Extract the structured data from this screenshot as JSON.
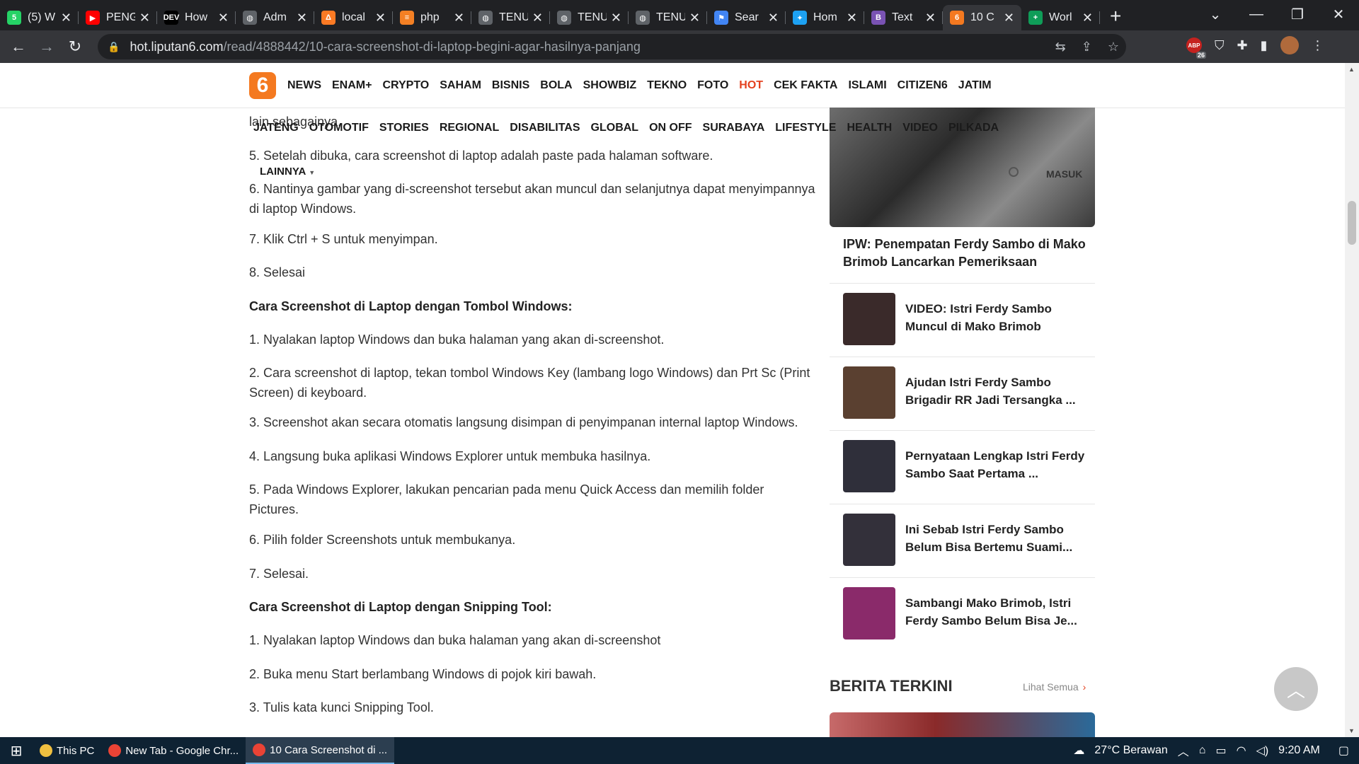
{
  "browser": {
    "tabs": [
      {
        "title": "(5) W",
        "favicon": "whatsapp-icon",
        "color": "#25d366",
        "glyph": "5"
      },
      {
        "title": "PENG",
        "favicon": "youtube-icon",
        "color": "#ff0000",
        "glyph": "▶"
      },
      {
        "title": "How",
        "favicon": "dev-icon",
        "color": "#000000",
        "glyph": "DEV"
      },
      {
        "title": "Adm",
        "favicon": "globe-icon",
        "color": "#5f6368",
        "glyph": "◍"
      },
      {
        "title": "local",
        "favicon": "xampp-icon",
        "color": "#fb7a24",
        "glyph": "Δ"
      },
      {
        "title": "php",
        "favicon": "stackoverflow-icon",
        "color": "#f48024",
        "glyph": "≡"
      },
      {
        "title": "TENU",
        "favicon": "globe-icon",
        "color": "#5f6368",
        "glyph": "◍"
      },
      {
        "title": "TENU",
        "favicon": "globe-icon",
        "color": "#5f6368",
        "glyph": "◍"
      },
      {
        "title": "TENU",
        "favicon": "globe-icon",
        "color": "#5f6368",
        "glyph": "◍"
      },
      {
        "title": "Sear",
        "favicon": "flag-icon",
        "color": "#4285f4",
        "glyph": "⚑"
      },
      {
        "title": "Hom",
        "favicon": "twitter-icon",
        "color": "#1da1f2",
        "glyph": "✦"
      },
      {
        "title": "Text",
        "favicon": "bootstrap-icon",
        "color": "#7952b3",
        "glyph": "B"
      },
      {
        "title": "10 C",
        "favicon": "liputan6-icon",
        "color": "#f47920",
        "glyph": "6",
        "active": true
      },
      {
        "title": "Worl",
        "favicon": "sheets-icon",
        "color": "#0f9d58",
        "glyph": "+"
      }
    ],
    "url_host": "hot.liputan6.com",
    "url_path": "/read/4888442/10-cara-screenshot-di-laptop-begini-agar-hasilnya-panjang",
    "extension_badge": "26",
    "extension_label": "ABP"
  },
  "site": {
    "logo": "6",
    "menu_primary": [
      "NEWS",
      "ENAM+",
      "CRYPTO",
      "SAHAM",
      "BISNIS",
      "BOLA",
      "SHOWBIZ",
      "TEKNO",
      "FOTO",
      "HOT",
      "CEK FAKTA",
      "ISLAMI",
      "CITIZEN6",
      "JATIM"
    ],
    "menu_secondary": [
      "JATENG",
      "OTOMOTIF",
      "STORIES",
      "REGIONAL",
      "DISABILITAS",
      "GLOBAL",
      "ON OFF",
      "SURABAYA",
      "LIFESTYLE",
      "HEALTH",
      "VIDEO",
      "PILKADA"
    ],
    "more_label": "LAINNYA",
    "login_label": "MASUK"
  },
  "article": {
    "paragraphs": [
      {
        "text": "lain sebagainya.",
        "heading": false
      },
      {
        "text": "5. Setelah dibuka, cara screenshot di laptop adalah paste pada halaman software.",
        "heading": false
      },
      {
        "text": "6. Nantinya gambar yang di-screenshot tersebut akan muncul dan selanjutnya dapat menyimpannya di laptop Windows.",
        "heading": false
      },
      {
        "text": "7. Klik Ctrl + S untuk menyimpan.",
        "heading": false
      },
      {
        "text": "8. Selesai",
        "heading": false
      },
      {
        "text": "Cara Screenshot di Laptop dengan Tombol Windows:",
        "heading": true
      },
      {
        "text": "1. Nyalakan laptop Windows dan buka halaman yang akan di-screenshot.",
        "heading": false
      },
      {
        "text": "2. Cara screenshot di laptop, tekan tombol Windows Key (lambang logo Windows) dan Prt Sc (Print Screen) di keyboard.",
        "heading": false
      },
      {
        "text": "3. Screenshot akan secara otomatis langsung disimpan di penyimpanan internal laptop Windows.",
        "heading": false
      },
      {
        "text": "4. Langsung buka aplikasi Windows Explorer untuk membuka hasilnya.",
        "heading": false
      },
      {
        "text": "5. Pada Windows Explorer, lakukan pencarian pada menu Quick Access dan memilih folder Pictures.",
        "heading": false
      },
      {
        "text": "6. Pilih folder Screenshots untuk membukanya.",
        "heading": false
      },
      {
        "text": "7. Selesai.",
        "heading": false
      },
      {
        "text": "Cara Screenshot di Laptop dengan Snipping Tool:",
        "heading": true
      },
      {
        "text": "1. Nyalakan laptop Windows dan buka halaman yang akan di-screenshot",
        "heading": false
      },
      {
        "text": "2. Buka menu Start berlambang Windows di pojok kiri bawah.",
        "heading": false
      },
      {
        "text": "3. Tulis kata kunci Snipping Tool.",
        "heading": false
      }
    ]
  },
  "sidebar": {
    "hero_title": "IPW: Penempatan Ferdy Sambo di Mako Brimob Lancarkan Pemeriksaan",
    "items": [
      {
        "title": "VIDEO: Istri Ferdy Sambo Muncul di Mako Brimob",
        "thumb_color": "#3a2a2a"
      },
      {
        "title": "Ajudan Istri Ferdy Sambo Brigadir RR Jadi Tersangka ...",
        "thumb_color": "#5a4030"
      },
      {
        "title": "Pernyataan Lengkap Istri Ferdy Sambo Saat Pertama ...",
        "thumb_color": "#2f2f3a"
      },
      {
        "title": "Ini Sebab Istri Ferdy Sambo Belum Bisa Bertemu Suami...",
        "thumb_color": "#33303a"
      },
      {
        "title": "Sambangi Mako Brimob, Istri Ferdy Sambo Belum Bisa Je...",
        "thumb_color": "#8a2a6a"
      }
    ],
    "section_title": "BERITA TERKINI",
    "see_all": "Lihat Semua"
  },
  "taskbar": {
    "items": [
      {
        "label": "This PC",
        "icon": "folder-icon",
        "color": "#f0c040"
      },
      {
        "label": "New Tab - Google Chr...",
        "icon": "chrome-icon",
        "color": "#ea4335"
      },
      {
        "label": "10 Cara Screenshot di ...",
        "icon": "chrome-icon",
        "color": "#ea4335",
        "active": true
      }
    ],
    "weather": "27°C  Berawan",
    "time": "9:20 AM"
  }
}
